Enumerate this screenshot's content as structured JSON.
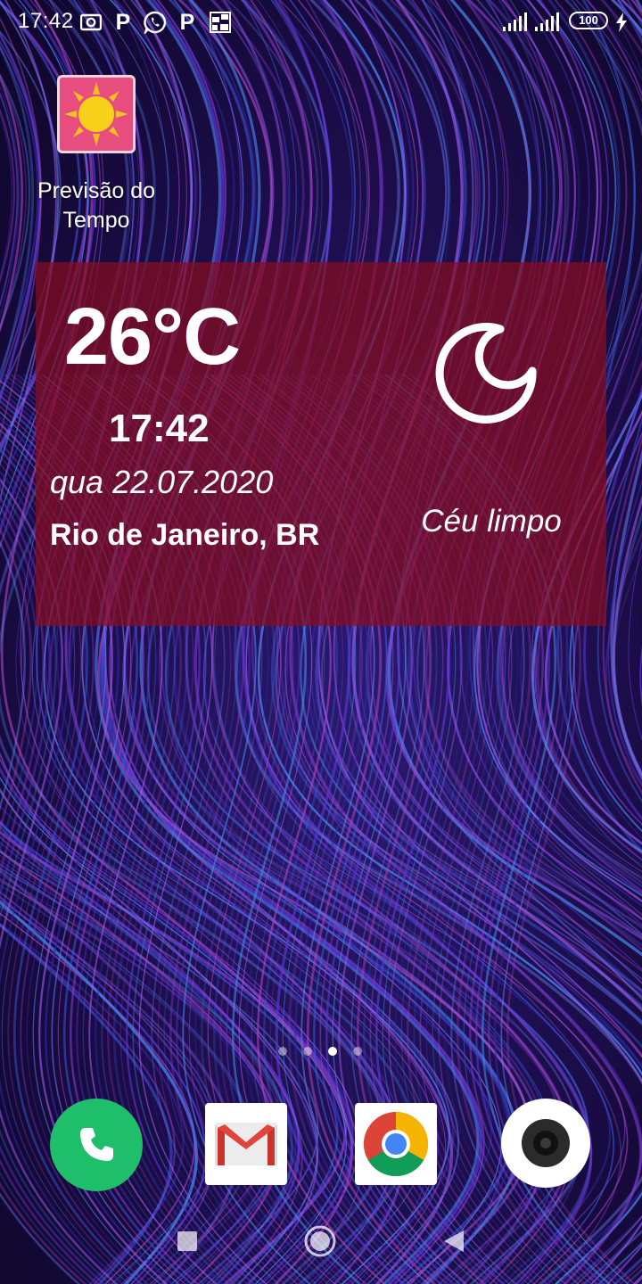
{
  "status_bar": {
    "time": "17:42",
    "notification_icons": [
      "screenshot-icon",
      "paypal-icon",
      "whatsapp-icon",
      "paypal-icon",
      "photo-icon"
    ],
    "battery_level": "100",
    "charging": true
  },
  "home": {
    "app_shortcut": {
      "label": "Previsão do Tempo",
      "icon": "sun-icon",
      "icon_bg_color": "#e84d80"
    }
  },
  "weather_widget": {
    "temperature": "26°C",
    "time": "17:42",
    "date": "qua 22.07.2020",
    "location": "Rio de Janeiro, BR",
    "condition": "Céu limpo",
    "condition_icon": "moon-icon",
    "bg_color": "#870c1e"
  },
  "pager": {
    "pages": 4,
    "current": 3
  },
  "dock": {
    "apps": [
      {
        "name": "phone",
        "icon": "phone-icon",
        "color": "#1ebe6a"
      },
      {
        "name": "gmail",
        "icon": "gmail-icon",
        "color": "#ea4335"
      },
      {
        "name": "chrome",
        "icon": "chrome-icon",
        "color": "#4285f4"
      },
      {
        "name": "camera",
        "icon": "camera-icon",
        "color": "#2a2a2a"
      }
    ]
  },
  "nav_bar": {
    "buttons": [
      "recents-icon",
      "home-icon",
      "back-icon"
    ]
  }
}
